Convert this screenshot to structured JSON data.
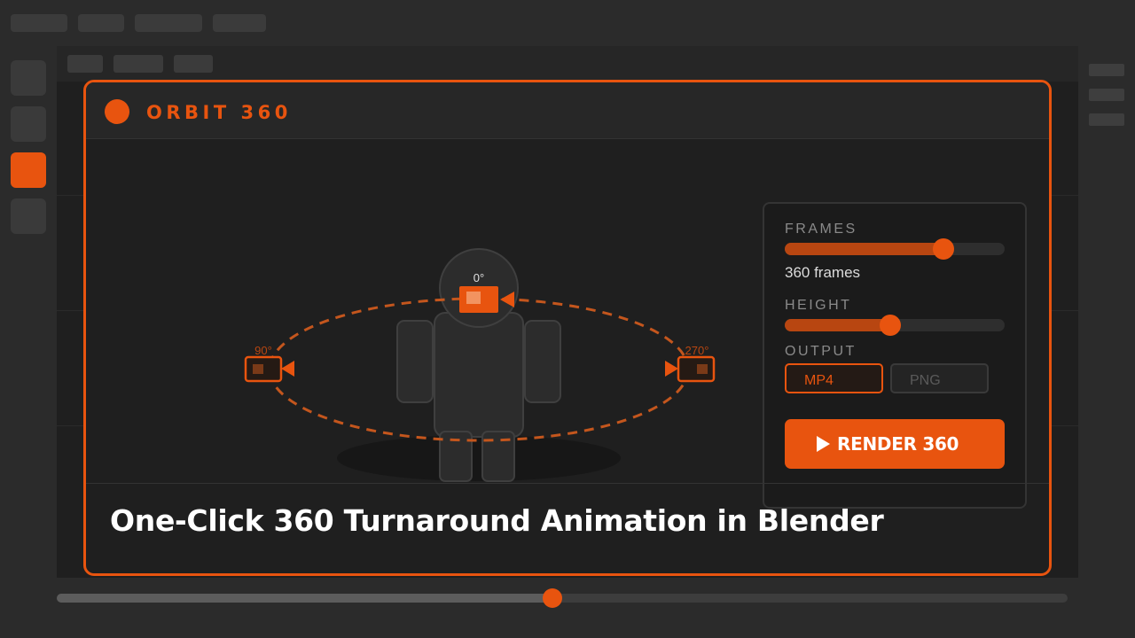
{
  "addon": {
    "title": "ORBIT 360",
    "accent_color": "#e8540f",
    "logo_icon": "orange-dot-icon"
  },
  "stage": {
    "camera_labels": [
      "0°",
      "90°",
      "270°"
    ],
    "camera_icon": "camera-icon",
    "subject": "character-mannequin"
  },
  "settings": {
    "frames_label": "FRAMES",
    "frames_value": "360 frames",
    "frames_slider_fraction": 0.72,
    "height_label": "HEIGHT",
    "height_slider_fraction": 0.48,
    "output_label": "OUTPUT",
    "output_options": [
      "MP4",
      "PNG"
    ],
    "output_selected": "MP4",
    "render_label": "RENDER 360",
    "render_icon": "play-icon"
  },
  "footer": {
    "title": "One-Click 360 Turnaround Animation in Blender"
  },
  "timeline": {
    "progress_fraction": 0.49
  }
}
